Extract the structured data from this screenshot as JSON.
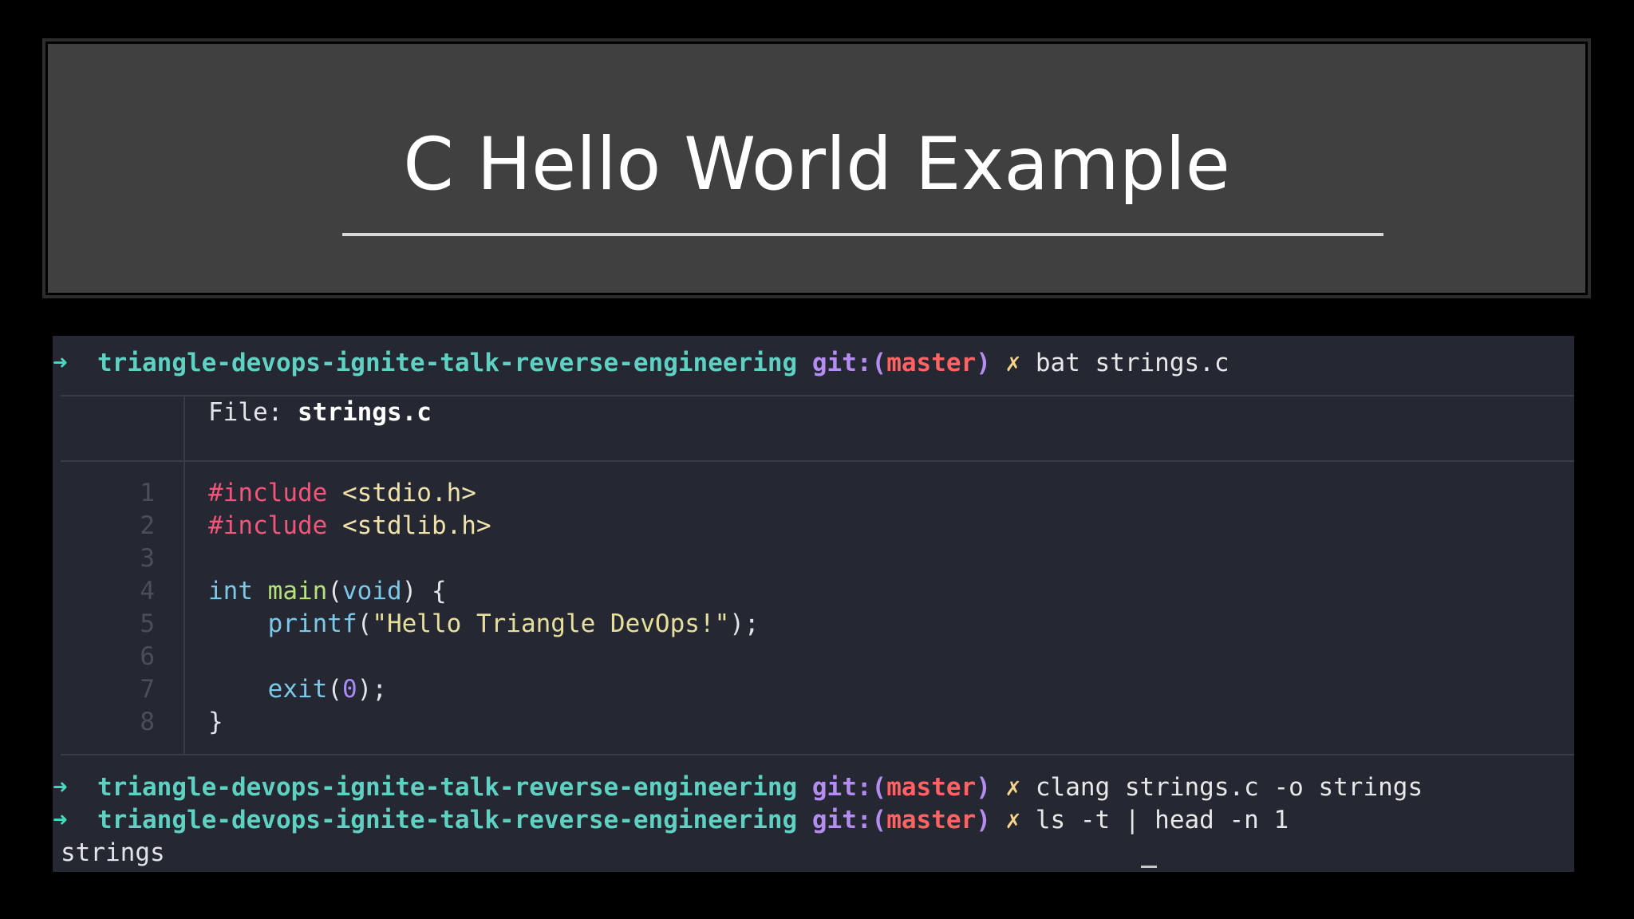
{
  "slide": {
    "title": "C Hello World Example"
  },
  "terminal": {
    "prompt": {
      "arrow": "➜",
      "repo": "triangle-devops-ignite-talk-reverse-engineering",
      "git_label": "git:",
      "paren_open": "(",
      "branch": "master",
      "paren_close": ")",
      "dirty_marker": "✗"
    },
    "commands": [
      "bat strings.c",
      "clang strings.c -o strings",
      "ls -t | head -n 1"
    ],
    "bat": {
      "file_label": "File: ",
      "file_name": "strings.c",
      "line_numbers": [
        "1",
        "2",
        "3",
        "4",
        "5",
        "6",
        "7",
        "8"
      ],
      "code": {
        "l1_directive": "#include",
        "l1_header": " <stdio.h>",
        "l2_directive": "#include",
        "l2_header": " <stdlib.h>",
        "l4_type": "int",
        "l4_fn": " main",
        "l4_open": "(",
        "l4_void": "void",
        "l4_close": ") {",
        "l5_indent": "    ",
        "l5_fn": "printf",
        "l5_open": "(",
        "l5_str": "\"Hello Triangle DevOps!\"",
        "l5_close": ");",
        "l7_indent": "    ",
        "l7_fn": "exit",
        "l7_open": "(",
        "l7_num": "0",
        "l7_close": ");",
        "l8_brace": "}"
      }
    },
    "output": "strings"
  },
  "colors": {
    "background": "#000000",
    "title_box": "#404040",
    "terminal_bg": "#252832",
    "prompt_arrow": "#3fdcc0",
    "repo": "#5fd1c3",
    "git": "#b58cf2",
    "branch": "#ff6262"
  }
}
